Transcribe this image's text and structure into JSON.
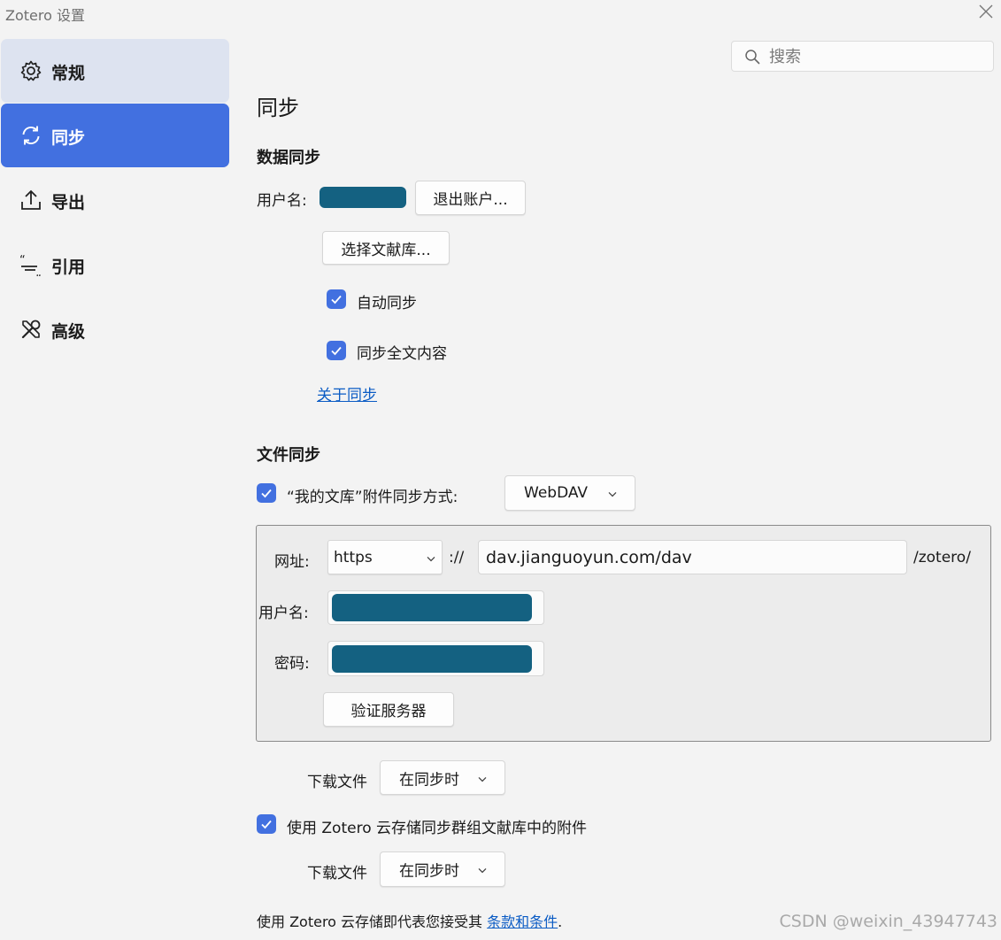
{
  "window": {
    "title": "Zotero 设置"
  },
  "sidebar": {
    "items": [
      {
        "label": "常规",
        "icon": "gear-icon"
      },
      {
        "label": "同步",
        "icon": "sync-icon",
        "selected": true
      },
      {
        "label": "导出",
        "icon": "export-icon"
      },
      {
        "label": "引用",
        "icon": "cite-icon"
      },
      {
        "label": "高级",
        "icon": "tools-icon"
      }
    ]
  },
  "search": {
    "placeholder": "搜索",
    "value": ""
  },
  "page": {
    "title": "同步"
  },
  "data_sync": {
    "title": "数据同步",
    "username_label": "用户名:",
    "logout_button": "退出账户...",
    "choose_library_button": "选择文献库...",
    "auto_sync": {
      "label": "自动同步",
      "checked": true
    },
    "sync_fulltext": {
      "label": "同步全文内容",
      "checked": true
    },
    "about_link": "关于同步"
  },
  "file_sync": {
    "title": "文件同步",
    "my_library": {
      "label": "“我的文库”附件同步方式:",
      "checked": true
    },
    "method_select": "WebDAV",
    "webdav": {
      "url_label": "网址:",
      "scheme_select": "https",
      "scheme_separator": "://",
      "url_value": "dav.jianguoyun.com/dav",
      "url_suffix": "/zotero/",
      "username_label": "用户名:",
      "password_label": "密码:",
      "verify_button": "验证服务器"
    },
    "download_files_label": "下载文件",
    "download_files_select": "在同步时",
    "group_storage": {
      "label": "使用 Zotero 云存储同步群组文献库中的附件",
      "checked": true
    },
    "group_download_label": "下载文件",
    "group_download_select": "在同步时"
  },
  "footer": {
    "text": "使用 Zotero 云存储即代表您接受其",
    "terms_link": "条款和条件",
    "period": "."
  },
  "watermark": "CSDN @weixin_43947743",
  "colors": {
    "accent": "#4270e0",
    "redaction": "#146181",
    "link": "#0a5bc4"
  }
}
